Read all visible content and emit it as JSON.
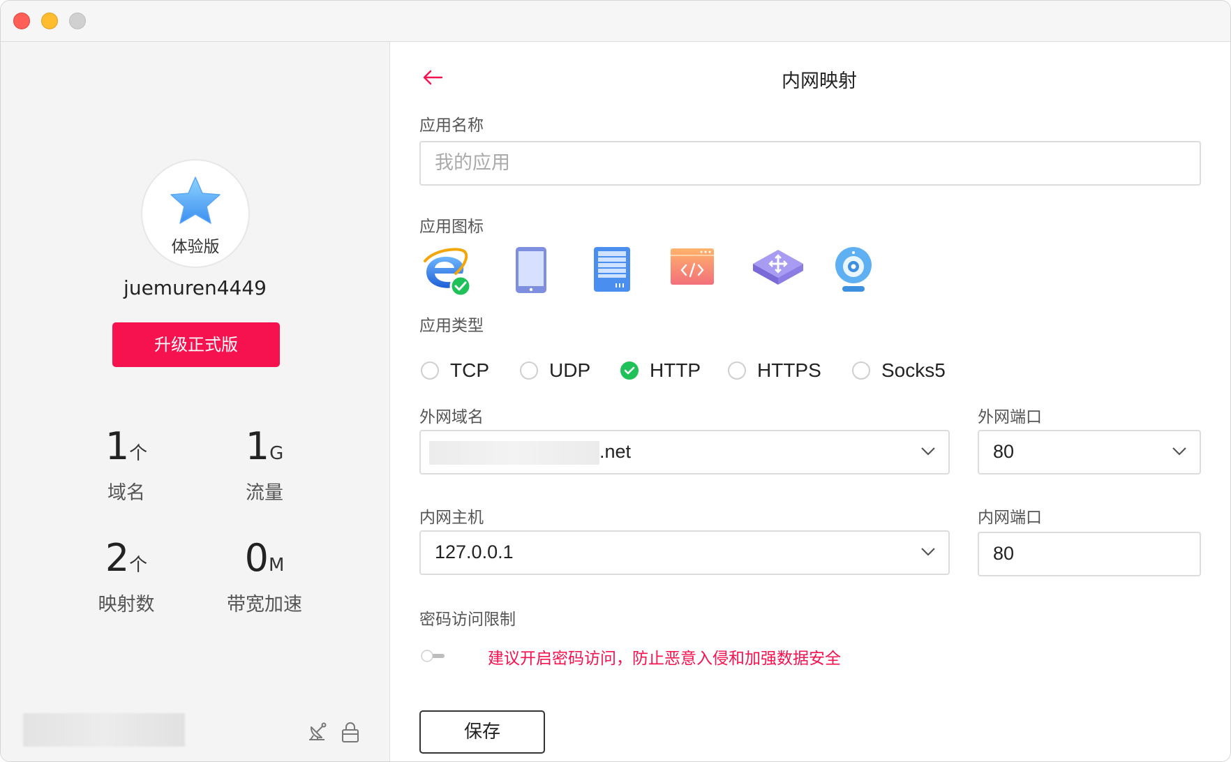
{
  "profile": {
    "badge": "体验版",
    "username": "juemuren4449",
    "upgrade_label": "升级正式版"
  },
  "stats": [
    {
      "value": "1",
      "unit": "个",
      "label": "域名"
    },
    {
      "value": "1",
      "unit": "G",
      "label": "流量"
    },
    {
      "value": "2",
      "unit": "个",
      "label": "映射数"
    },
    {
      "value": "0",
      "unit": "M",
      "label": "带宽加速"
    }
  ],
  "header": {
    "title": "内网映射"
  },
  "form": {
    "app_name_label": "应用名称",
    "app_name_placeholder": "我的应用",
    "app_icon_label": "应用图标",
    "app_icons": [
      "ie-icon",
      "tablet-icon",
      "server-icon",
      "code-window-icon",
      "router-icon",
      "webcam-icon"
    ],
    "app_type_label": "应用类型",
    "app_types": [
      "TCP",
      "UDP",
      "HTTP",
      "HTTPS",
      "Socks5"
    ],
    "app_type_selected": "HTTP",
    "domain_label": "外网域名",
    "domain_suffix": ".net",
    "ext_port_label": "外网端口",
    "ext_port_value": "80",
    "host_label": "内网主机",
    "host_value": "127.0.0.1",
    "int_port_label": "内网端口",
    "int_port_value": "80",
    "password_label": "密码访问限制",
    "password_enabled": false,
    "password_warning": "建议开启密码访问，防止恶意入侵和加强数据安全",
    "save_label": "保存"
  },
  "colors": {
    "accent": "#f5124f",
    "success": "#21c15a"
  }
}
